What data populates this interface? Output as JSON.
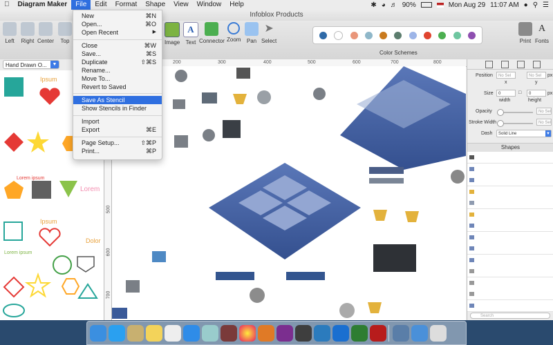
{
  "menubar": {
    "apple": "",
    "app_name": "Diagram Maker",
    "items": [
      "File",
      "Edit",
      "Format",
      "Shape",
      "View",
      "Window",
      "Help"
    ],
    "battery": "90%",
    "date": "Mon Aug 29",
    "time": "11:07 AM"
  },
  "window": {
    "title": "Infoblox Products"
  },
  "toolbar": {
    "left_labels": [
      "Left",
      "Right",
      "Center",
      "Top"
    ],
    "tools": [
      "Image",
      "Text",
      "Connector",
      "Zoom",
      "Pan",
      "Select"
    ],
    "color_schemes_label": "Color Schemes",
    "print_label": "Print",
    "fonts_label": "Fonts",
    "swatches": [
      "#2f6aa8",
      "#ffffff",
      "#e9967a",
      "#8fb7c9",
      "#c97a1e",
      "#5c7d6e",
      "#9db5e8",
      "#e0442f",
      "#4caf50",
      "#6ec6a0",
      "#8e4fb0"
    ]
  },
  "stencil": {
    "selected": "Hand Drawn O...",
    "labels": [
      "Ipsum",
      "Lorem ipsum",
      "Lorem",
      "Ipsum",
      "Dolor",
      "Lorem ipsum"
    ]
  },
  "ruler": {
    "h_ticks": [
      "200",
      "300",
      "400",
      "500",
      "600",
      "700",
      "800"
    ],
    "v_ticks": [
      "500",
      "600",
      "700"
    ]
  },
  "filemenu": {
    "items": [
      {
        "label": "New",
        "key": "⌘N"
      },
      {
        "label": "Open...",
        "key": "⌘O"
      },
      {
        "label": "Open Recent",
        "key": "▶"
      },
      {
        "label": "Close",
        "key": "⌘W"
      },
      {
        "label": "Save...",
        "key": "⌘S"
      },
      {
        "label": "Duplicate",
        "key": "⇧⌘S"
      },
      {
        "label": "Rename...",
        "key": ""
      },
      {
        "label": "Move To...",
        "key": ""
      },
      {
        "label": "Revert to Saved",
        "key": ""
      },
      {
        "label": "Save As Stencil",
        "key": ""
      },
      {
        "label": "Show Stencils in Finder",
        "key": ""
      },
      {
        "label": "Import",
        "key": ""
      },
      {
        "label": "Export",
        "key": "⌘E"
      },
      {
        "label": "Page Setup...",
        "key": "⇧⌘P"
      },
      {
        "label": "Print...",
        "key": "⌘P"
      }
    ],
    "highlighted": "Save As Stencil"
  },
  "inspector": {
    "position_label": "Position",
    "x_label": "x",
    "y_label": "y",
    "size_label": "Size",
    "width_label": "width",
    "height_label": "height",
    "size_width_value": "0",
    "size_height_value": "0",
    "px": "px",
    "no_sel": "No Sel",
    "opacity_label": "Opacity",
    "stroke_label": "Stroke Width",
    "dash_label": "Dash",
    "dash_value": "Solid Line",
    "shapes_header": "Shapes",
    "search_placeholder": "Search"
  }
}
